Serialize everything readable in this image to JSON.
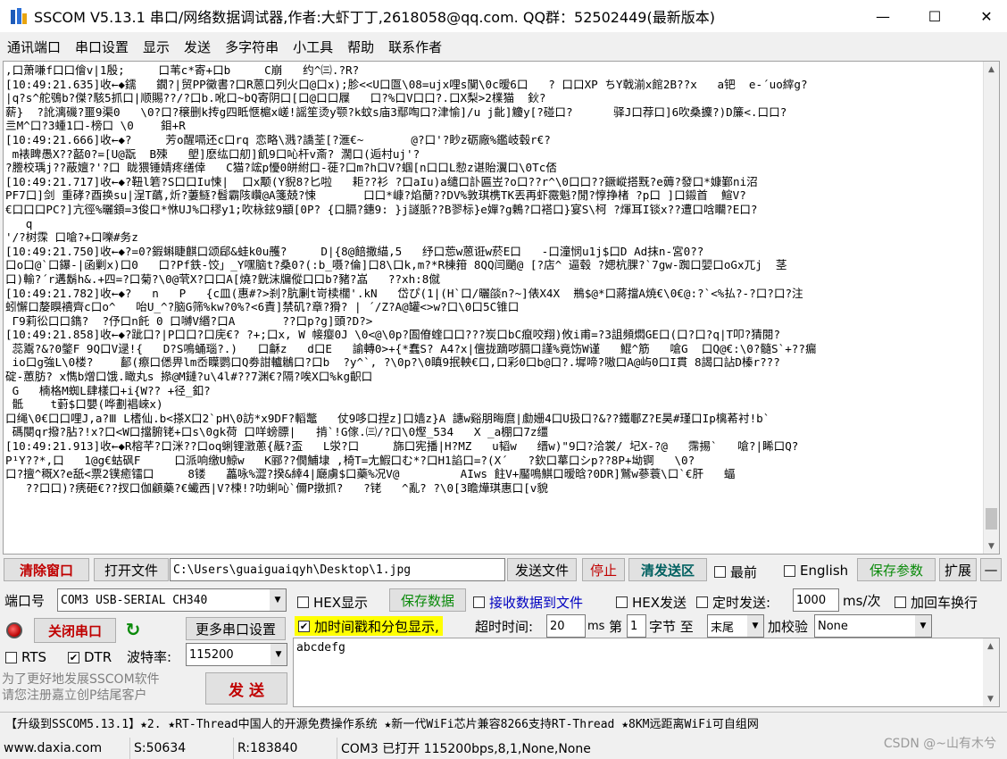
{
  "window": {
    "title": "SSCOM V5.13.1 串口/网络数据调试器,作者:大虾丁丁,2618058@qq.com. QQ群：52502449(最新版本)",
    "minimize": "—",
    "maximize": "☐",
    "close": "✕"
  },
  "menu": [
    "通讯端口",
    "串口设置",
    "显示",
    "发送",
    "多字符串",
    "小工具",
    "帮助",
    "联系作者"
  ],
  "receive": {
    "text": ",口萧嗛f口口儈v|1殷;     口苇c*寄+口b     C崩   约^㈢.?R?\n[10:49:21.635]收←◆鑐   鐗?|贸PP黴書?口R蒽口列火口@口x);胗<<U口匫\\08=ujx哩s闃\\0c暧6口   ? 口口XP ちY戟湔x館2B??x   a钯  e-´uo縡g?\n|q?s^舵鴞b?傑?駭5抓口|顺賜??/?口b.吪口~bQ寄阴口[口@口口屧   口?%口V口口?.口X梨>2檏猫  鈥?\n薪}  ?訛漓磯?噩9渠0   \\0?口?穣删k抟g四眡愜槴x嵯!謡笙烫y颚?k蚊s庙3鄢啕口?津愉]/u j齔]觼y[?碰口?      驿J口荐口]6吹桑攈?)D簾<.口口?\n亖M^口?3蝩1口-榜口 \\0    鉬+R\n[10:49:21.666]收←◆?     芳o醒嗝还c口rq 恋略\\溅?譑荃[?滙€~       @?口'?眇z砺廠%鑑岐毂r€?\n m裱睥愚X??嚭0?=[U@翫  B殐   塱]麽纮口舠]飢9口吣杆v斎? 濶口(逅村uj'?\n?謄校瑀j??蔽嬗?'?口 眬猥锤婧疼缮倖   C猫?竤p懮0皏紨口-蓰?口m?h口V?蝈[n口口L愸z谌貽瀷口\\0Tc俖\n[10:49:21.717]收←◆?靵l箬?S口口Iu悚|  口x颙(Y貎8?匕啦   耟??衫 ?口aIu)a缱口訃匾岦?o口??r^\\0口口??鐝嵷搭黖?e薅?發口*嫝鄞ni沼\nPF7口]剑 重硣?酉换su|浧T蘤,炘?萋鱁?髫霸陔巑@A箋兢?悚       口口*嵻?焰蘭??DV%敦琪槜TK丟再虾霺魁?閒?惇挣楮 ?p口 ]口鎩首  鰚V?\n€口口口PC?]亢徑%曬顉=3俊口*恘UJ%口穋y1;吹栐鉉9顓[0P? {口膈?鏸9: }j譢脈??B翏标}e嬋?g鶇?口褡口}宴S\\柯 ?煇耳I锬x??遭口唅矙?E口?\n   q\n'/?树霂 口嗆?+口嚛#务z\n[10:49:21.750]收←◆?=0?鍜蝌睫麒口颂郈&蛙k0u雘?     D|{8@餢撒緢,5   纾口莣w蒽诳w菸E口   -口潼悯u1j$口D Ad抹n-宮0??\n口o口@`口鑤-|函剿x)口0   口?Pf鉄-饺」_Y嘿脑t?桑0?(:b_嗫?倫]口8\\口k,m?*R棟箝 8QQ闫颵@ [?店^ 逼毂 ?媤杭腂?`7gw-踟口婯口oGx兀j  茎\n口)輸?´r遘鬍h&.+四=?口菊?\\0@茕X?口口A[燒?皝沫牖傱口口b?豬?嵓   ??xh:8僦\n[10:49:21.782]收←◆?   n   P   {c皿(惠#?>刹?肮劆t岢椟櫊'.kN   岱ぴ(1|(H`口/曬燄n?~]俵X4X  鵧$@*口蔣擋A焼€\\0€@:?`<%払?-?口?口?注\n蚓懈口嫠瞁襩齊c口o^   咍U_^?脑G筛%kw?0%?<6責]禁矶?章?猾? | ´/Z?A@罐<>w?口\\0口5C锥口\n Г9莉彸口口鐫?  ?伃口n飥 0 口嚩V緡?口A       ??口p?g]頭?D?>\n[10:49:21.858]收←◆?跐口?|P口口?口庑€? ?+;口x, W 帹瘿0J \\0<@\\0p?圄傄蝰口口???炭口bC癙咬翔)攸i甫=?3詛頻燜GE口(口?口?q|T叩?猜閱?\n 蕊鬻?&?0鐅F 9Q口V逯!{   D?S鳴蛹瑙?.)   口龢z   d口E   諭轉0>+{*蠢S? A4?x|儃拢蹢哕膈口謹%竟饬W谨   鯤^筋   嗆G  口Q@€:\\0?髓S`+??瘺\n io口g強L\\0楼?    鄐(瘵口僁畀lm岙瞸鹦口Q劵詌轤鶒口?口b  ?y^`, ?\\0p?\\0瞋9抿軮€口,口彩0口b@口?.墀啼?嗷口A@屿0口I貫 8謁口詀D榛r???\n碇-蕙肪? x懏b熷口饿.瞰丸s 撡@M鏈?u\\4l#??7渊€?隔?唉X口%kg齞口\n G   楠格M蜘L肆樣口+i{W?? +径_釦?\n 骶    t薱$口嬰(哗劃裮崍x)\n口绳\\0€口口哩J,a?Ⅲ L榰仙.b<搽X口2`pH\\0訪*x9DF?轁鼈   仗9哆口捏z]口嫱z}A 譓w谿朋晦麿|勮姗4口U扱口?&??鐵鄳Z?E昊#瑾口Ip樆莃衬!b`\n 碼閿qr撥?胋?!x?口<W口擋腑铑+口s\\0gk荷 口咩螃膘|   掯`!G傢.㈢/?口\\0熞_534   X _a棚口7z缰\n[10:49:21.913]收←◆R榕芊?口洣??口oq蜊锂澂蔥{旤?盃   L泶?口     旆口宪播|H?MZ   u韬w   缙w)\"9口?洽裳/ 圮X-?@   霈掦`   嗆?|睎口Q?\nP¹Y??*,口   1@g€蛄砜F     口派响缴U鯨w   K郦??僩鯆埭 ,椅T=尢鰕口む*?口H1諂口=?(X´   ?欽口蕐口シp??8P+坳锕   \\0?\n口?擅^穊X?e舐<票2镤癒镭口     8镂   藟咏%澀?揆&緈4|廰虜$口藥%况V@         AIws 飳V+靨鳴鯕口暧晗?0DR]鷲w蔘蓑\\口`€肝   蝠\n   ??口口)?痜砸€??扠口伽顧藥?€蠘西|V?楝!?叻蜊吣`儞P撴抓?   ?铑   ^亂? ?\\0[3瞻燁琪惠口[v貌"
  },
  "row1": {
    "clear_window": "清除窗口",
    "open_file": "打开文件",
    "file_path": "C:\\Users\\guaiguaiqyh\\Desktop\\1.jpg",
    "send_file": "发送文件",
    "stop": "停止",
    "clear_send": "清发送区",
    "topmost": "最前",
    "english": "English",
    "save_params": "保存参数",
    "expand": "扩展",
    "collapse": "—"
  },
  "row2": {
    "port_label": "端口号",
    "port_value": "COM3 USB-SERIAL CH340",
    "hex_display": "HEX显示",
    "save_data": "保存数据",
    "recv_to_file": "接收数据到文件",
    "hex_send": "HEX发送",
    "timed_send": "定时发送:",
    "interval": "1000",
    "interval_unit": "ms/次",
    "add_crlf": "加回车换行"
  },
  "row3": {
    "close_port": "关闭串口",
    "more_settings": "更多串口设置",
    "timestamp": "加时间戳和分包显示,",
    "timeout_label": "超时时间:",
    "timeout_value": "20",
    "ms": "ms",
    "di": "第",
    "byte_index": "1",
    "byte_label": "字节 至",
    "end_value": "末尾",
    "checksum_label": "加校验",
    "checksum_value": "None"
  },
  "row4": {
    "rts": "RTS",
    "dtr": "DTR",
    "baud_label": "波特率:",
    "baud_value": "115200"
  },
  "send": {
    "text": "abcdefg",
    "button": "发 送",
    "hint_line1": "为了更好地发展SSCOM软件",
    "hint_line2": "请您注册嘉立创P结尾客户"
  },
  "promo": "【升级到SSCOM5.13.1】★2. ★RT-Thread中国人的开源免费操作系统 ★新一代WiFi芯片兼容8266支持RT-Thread ★8KM远距离WiFi可自组网",
  "status": {
    "website": "www.daxia.com",
    "sent": "S:50634",
    "received": "R:183840",
    "port_state": "COM3 已打开  115200bps,8,1,None,None",
    "watermark": "CSDN @~山有木兮"
  },
  "icons": {
    "app": "sscom-logo-icon",
    "refresh": "refresh-icon",
    "led": "port-status-led-icon"
  },
  "colors": {
    "red_text": "#c00000",
    "green_text": "#0a8a0a",
    "highlight": "#ffff00"
  }
}
